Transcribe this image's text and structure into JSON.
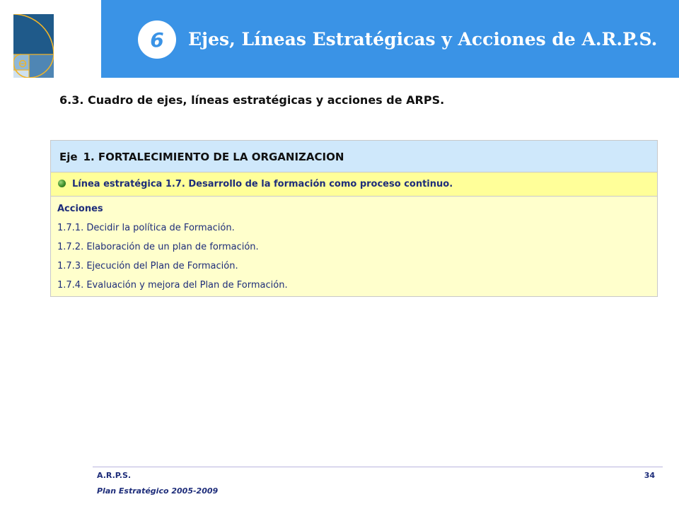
{
  "header": {
    "chapter_number": "6",
    "title": "Ejes, Líneas Estratégicas y Acciones de A.R.P.S."
  },
  "section": {
    "title": "6.3. Cuadro de ejes, líneas estratégicas y acciones de ARPS."
  },
  "table": {
    "eje_label": "Eje",
    "eje_value": "1. FORTALECIMIENTO DE LA ORGANIZACION",
    "linea": "Línea estratégica 1.7. Desarrollo de la formación como proceso continuo.",
    "acciones_title": "Acciones",
    "acciones": [
      "1.7.1. Decidir la política de Formación.",
      "1.7.2. Elaboración de un plan de formación.",
      "1.7.3. Ejecución del Plan de Formación.",
      "1.7.4. Evaluación y mejora del Plan de Formación."
    ]
  },
  "footer": {
    "org": "A.R.P.S.",
    "plan": "Plan Estratégico 2005-2009",
    "page_number": "34"
  },
  "colors": {
    "header_blue": "#3a93e6",
    "eje_row": "#cfe8fb",
    "linea_row": "#ffff99",
    "acciones_row": "#ffffcc",
    "text_navy": "#1e2d7a"
  }
}
